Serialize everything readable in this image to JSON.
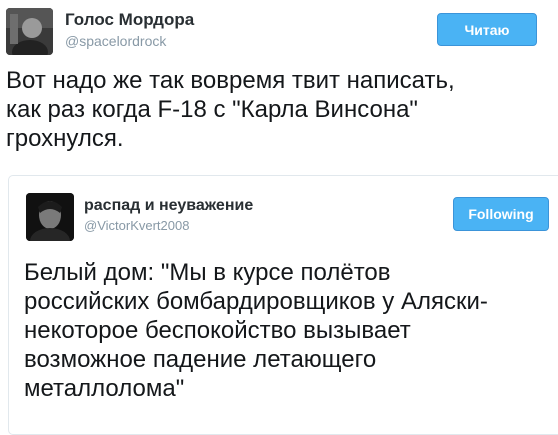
{
  "tweet": {
    "author_name": "Голос Мордора",
    "author_handle": "@spacelordrock",
    "follow_label": "Читаю",
    "text_lines": [
      "Вот надо же так вовремя твит написать,",
      "как раз когда F-18 с \"Карла Винсона\"",
      "грохнулся."
    ]
  },
  "quoted_tweet": {
    "author_name": "распад и неуважение",
    "author_handle": "@VictorKvert2008",
    "follow_label": "Following",
    "text_lines": [
      "Белый дом: \"Мы в курсе полётов",
      "российских бомбардировщиков у Аляски-",
      "некоторое беспокойство вызывает",
      "возможное падение летающего",
      "металлолома\""
    ]
  },
  "colors": {
    "accent": "#4ab3f4",
    "accent_border": "#3b94d9",
    "handle_gray": "#8899a6",
    "quote_border": "#e1e8ed"
  },
  "icons": {
    "author_avatar": "avatar-photo-icon",
    "quoted_avatar": "avatar-photo-icon"
  }
}
